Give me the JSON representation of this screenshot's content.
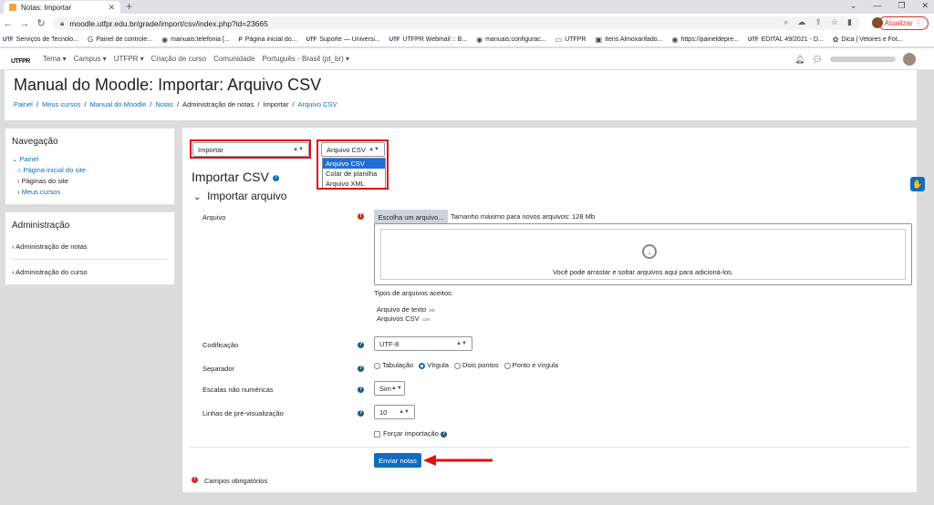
{
  "browser": {
    "tab_title": "Notas: Importar",
    "url": "moodle.utfpr.edu.br/grade/import/csv/index.php?id=23665",
    "update_label": "Atualizar",
    "bookmarks": [
      {
        "icon": "UTF",
        "label": "Serviços de Tecnolo..."
      },
      {
        "icon": "G",
        "label": "Painel de controle..."
      },
      {
        "icon": "◉",
        "label": "manuais:telefonia [..."
      },
      {
        "icon": "P",
        "label": "Página inicial do..."
      },
      {
        "icon": "UTF",
        "label": "Suporte — Universi..."
      },
      {
        "icon": "UTF",
        "label": "UTFPR Webmail :: B..."
      },
      {
        "icon": "◉",
        "label": "manuais:configurac..."
      },
      {
        "icon": "▭",
        "label": "UTFPR"
      },
      {
        "icon": "▣",
        "label": "Itens Almoxarifado..."
      },
      {
        "icon": "◉",
        "label": "https://paineldepre..."
      },
      {
        "icon": "UTF",
        "label": "EDITAL 49/2021 - D..."
      },
      {
        "icon": "✿",
        "label": "Dica | Vetores e Fot..."
      }
    ]
  },
  "moodle_nav": {
    "logo_main": "UT",
    "logo_sub": "FPR",
    "menu": [
      "Tema ▾",
      "Campus ▾",
      "UTFPR ▾",
      "Criação de curso",
      "Comunidade",
      "Português - Brasil (pt_br) ▾"
    ]
  },
  "header": {
    "title": "Manual do Moodle: Importar: Arquivo CSV",
    "breadcrumb": [
      "Painel",
      "Meus cursos",
      "Manual do Moodle",
      "Notas",
      "Administração de notas",
      "Importar",
      "Arquivo CSV"
    ]
  },
  "nav_block": {
    "title": "Navegação",
    "painel": "Painel",
    "home": "Página inicial do site",
    "pages": "Páginas do site",
    "courses": "Meus cursos"
  },
  "admin_block": {
    "title": "Administração",
    "items": [
      "Administração de notas",
      "Administração do curso"
    ]
  },
  "form": {
    "select1": "Importar",
    "select2": "Arquivo CSV",
    "dropdown_options": [
      "Arquivo CSV",
      "Colar de planilha",
      "Arquivo XML"
    ],
    "heading": "Importar CSV",
    "section": "Importar arquivo",
    "file_label": "Arquivo",
    "file_button": "Escolha um arquivo...",
    "max_size": "Tamanho máximo para novos arquivos: 128 Mb",
    "dropzone_text": "Você pode arrastar e soltar arquivos aqui para adicioná-los.",
    "accepted_label": "Tipos de arquivos aceitos:",
    "accepted_1": "Arquivo de texto",
    "accepted_1_ext": ".txt",
    "accepted_2": "Arquivos CSV",
    "accepted_2_ext": ".csv",
    "encoding_label": "Codificação",
    "encoding_value": "UTF-8",
    "separator_label": "Separador",
    "separators": [
      "Tabulação",
      "Vírgula",
      "Dois pontos",
      "Ponto e vírgula"
    ],
    "scales_label": "Escalas não numéricas",
    "scales_value": "Sim",
    "preview_label": "Linhas de pré-visualização",
    "preview_value": "10",
    "force_label": "Forçar importação",
    "submit": "Enviar notas",
    "required": "Campos obrigatórios"
  }
}
